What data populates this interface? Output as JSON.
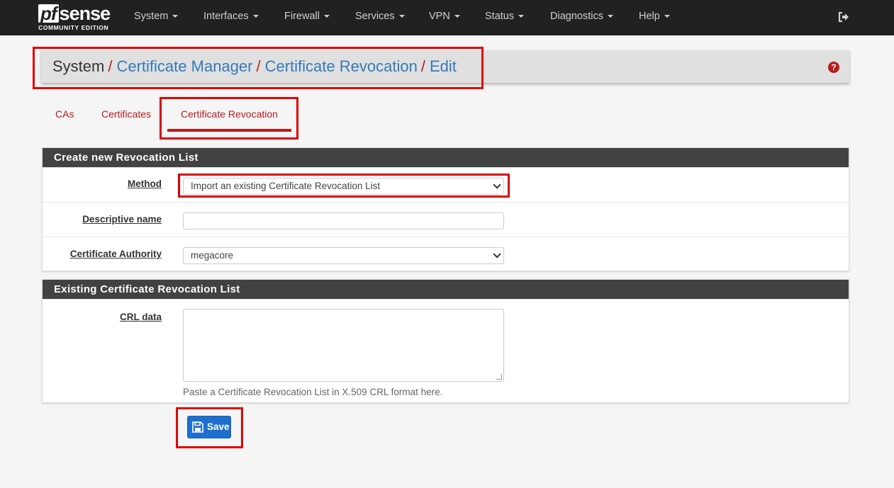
{
  "brand": {
    "logo_pf": "pf",
    "logo_sense": "sense",
    "logo_sub": "COMMUNITY EDITION"
  },
  "nav": {
    "items": [
      {
        "label": "System"
      },
      {
        "label": "Interfaces"
      },
      {
        "label": "Firewall"
      },
      {
        "label": "Services"
      },
      {
        "label": "VPN"
      },
      {
        "label": "Status"
      },
      {
        "label": "Diagnostics"
      },
      {
        "label": "Help"
      }
    ],
    "logout_icon": "sign-out-icon"
  },
  "breadcrumb": {
    "root": "System",
    "sep": "/",
    "items": [
      "Certificate Manager",
      "Certificate Revocation",
      "Edit"
    ],
    "help_icon": "question-circle-icon",
    "help_glyph": "?"
  },
  "tabs": [
    {
      "label": "CAs",
      "active": false
    },
    {
      "label": "Certificates",
      "active": false
    },
    {
      "label": "Certificate Revocation",
      "active": true
    }
  ],
  "panel_new": {
    "title": "Create new Revocation List",
    "method_label": "Method",
    "method_value": "Import an existing Certificate Revocation List",
    "descr_label": "Descriptive name",
    "descr_value": "",
    "ca_label": "Certificate Authority",
    "ca_value": "megacore"
  },
  "panel_existing": {
    "title": "Existing Certificate Revocation List",
    "crl_label": "CRL data",
    "crl_value": "",
    "crl_help": "Paste a Certificate Revocation List in X.509 CRL format here."
  },
  "save": {
    "label": "Save",
    "icon": "save-icon"
  },
  "colors": {
    "navbar": "#212121",
    "accent_red": "#b71c1c",
    "link_blue": "#337ab7",
    "button_blue": "#1e6fce",
    "highlight": "#e00000"
  }
}
